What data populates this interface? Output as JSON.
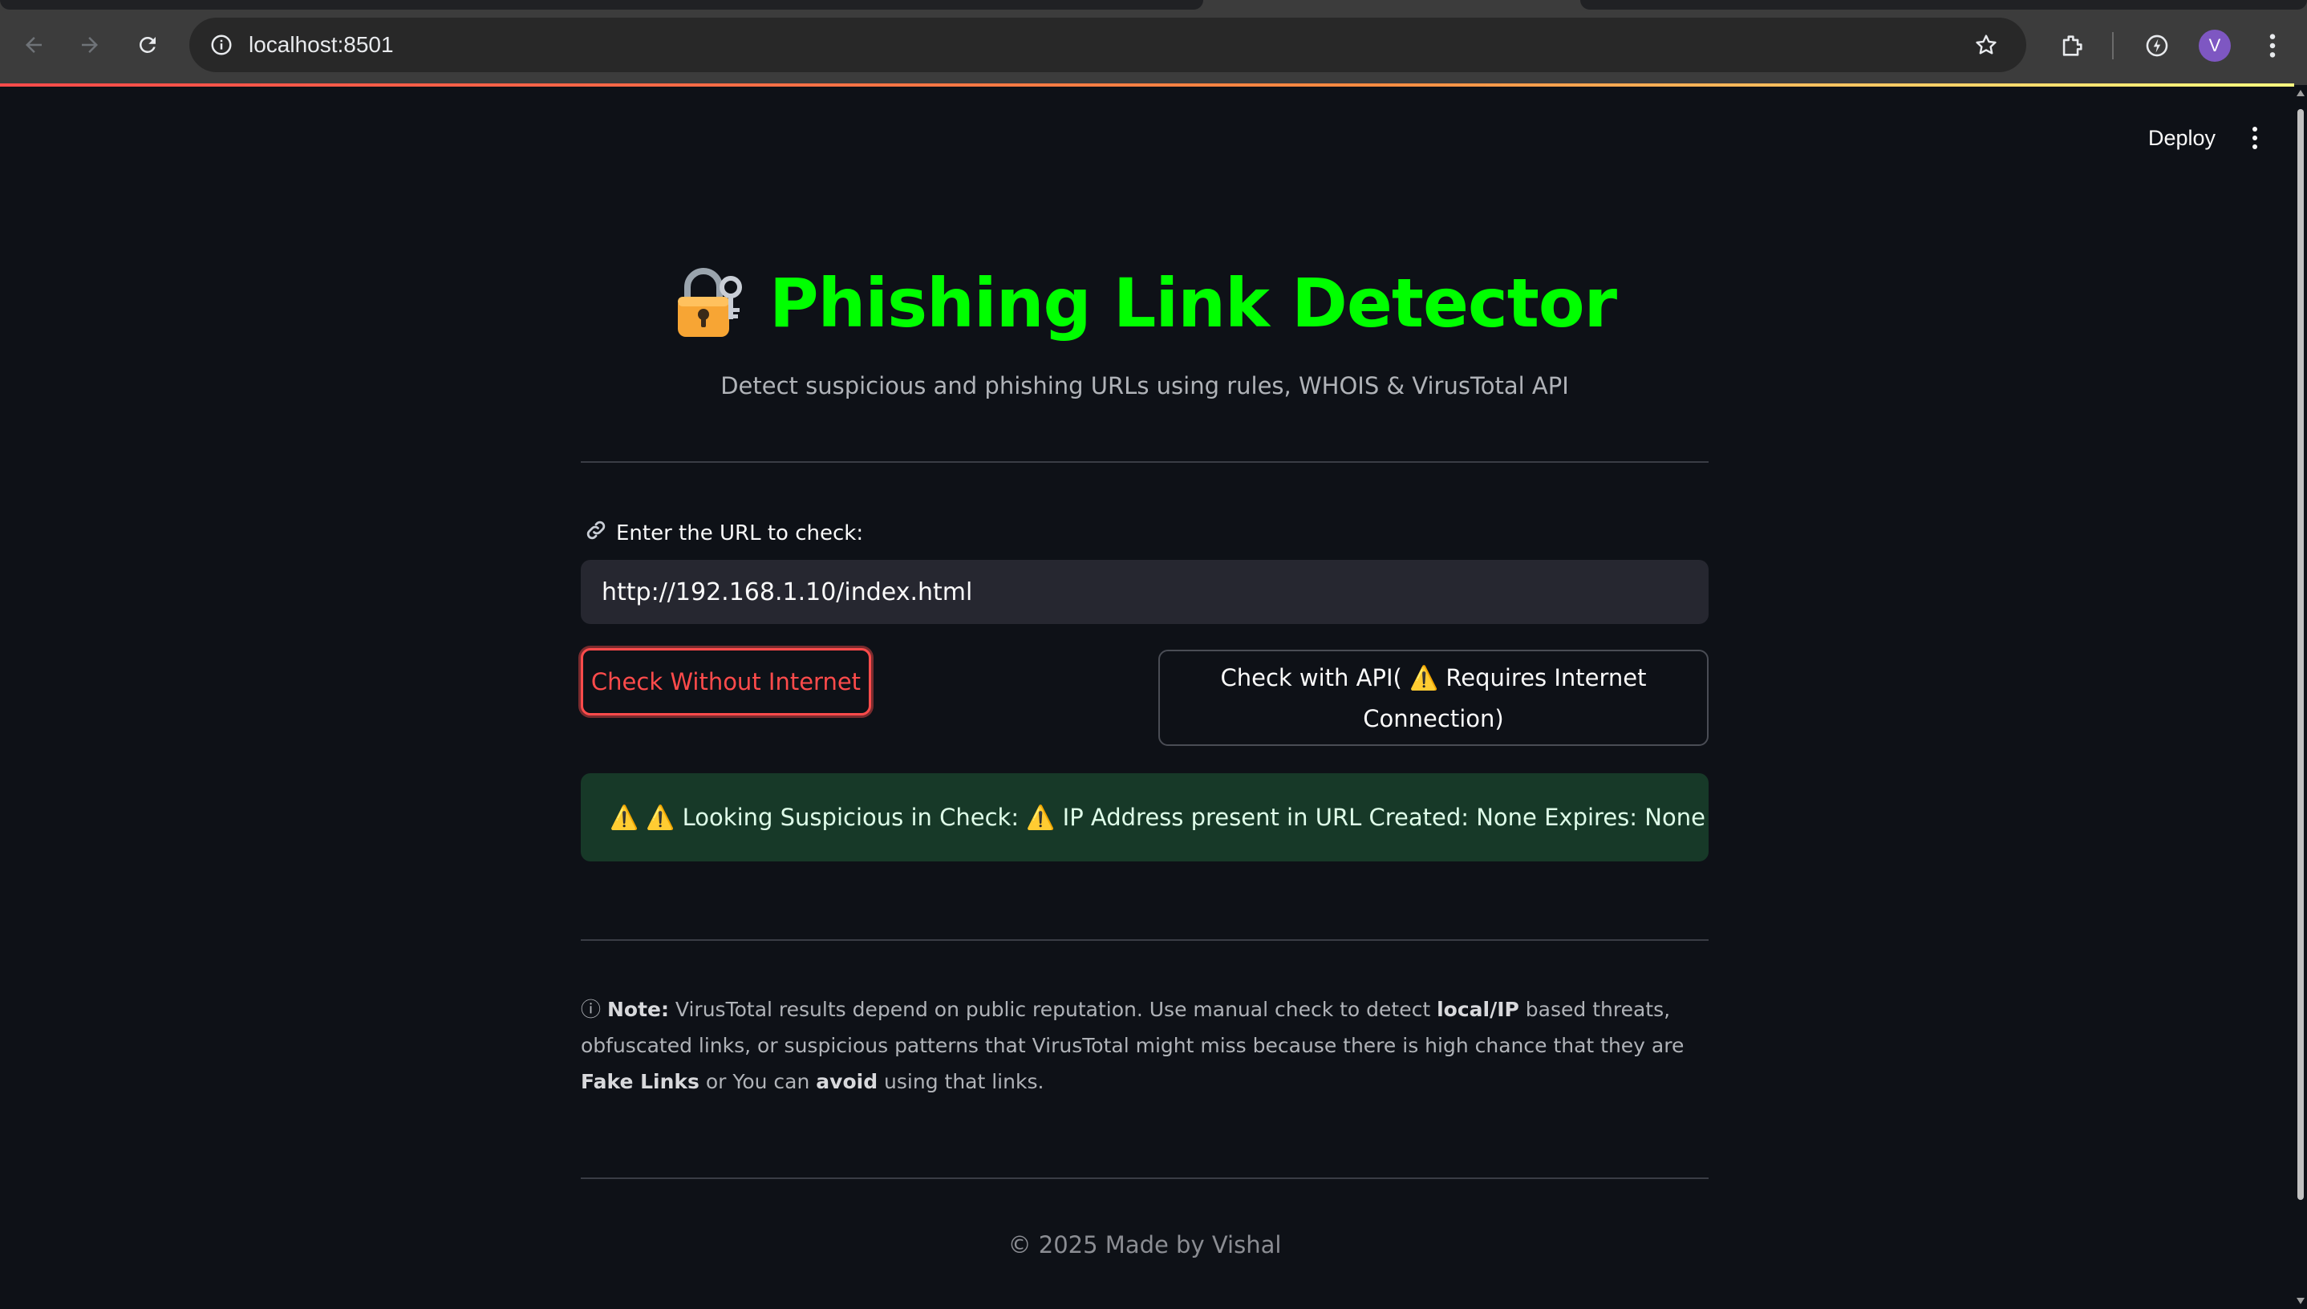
{
  "browser": {
    "url": "localhost:8501",
    "avatar_letter": "V"
  },
  "header": {
    "deploy_label": "Deploy"
  },
  "app": {
    "title": "Phishing Link Detector",
    "subtitle": "Detect suspicious and phishing URLs using rules, WHOIS & VirusTotal API",
    "input_label": "Enter the URL to check:",
    "input_value": "http://192.168.1.10/index.html",
    "button_offline": "Check Without Internet",
    "button_api_line1": "Check with API( ⚠️ Requires Internet",
    "button_api_line2": "Connection)",
    "alert_text": "⚠️ ⚠️ Looking Suspicious in Check:  ⚠️ IP Address present in URL Created: None Expires: None",
    "note": {
      "icon": "ⓘ",
      "p1_bold": "Note:",
      "p2": " VirusTotal results depend on public reputation. Use manual check to detect ",
      "p3_bold": "local/IP",
      "p4": " based threats, obfuscated links, or suspicious patterns that VirusTotal might miss because there is high chance that they are ",
      "p5_bold": "Fake Links",
      "p6": " or You can ",
      "p7_bold": "avoid",
      "p8": " using that links."
    },
    "footer": "© 2025 Made by Vishal"
  },
  "colors": {
    "title_green": "#00ff00",
    "primary_red": "#ff4b4b",
    "alert_bg": "#173928",
    "page_bg": "#0e1117"
  },
  "icons": [
    "back-arrow-icon",
    "forward-arrow-icon",
    "reload-icon",
    "site-info-icon",
    "star-icon",
    "extensions-icon",
    "performance-icon",
    "kebab-menu-icon",
    "lock-key-icon",
    "link-icon"
  ]
}
